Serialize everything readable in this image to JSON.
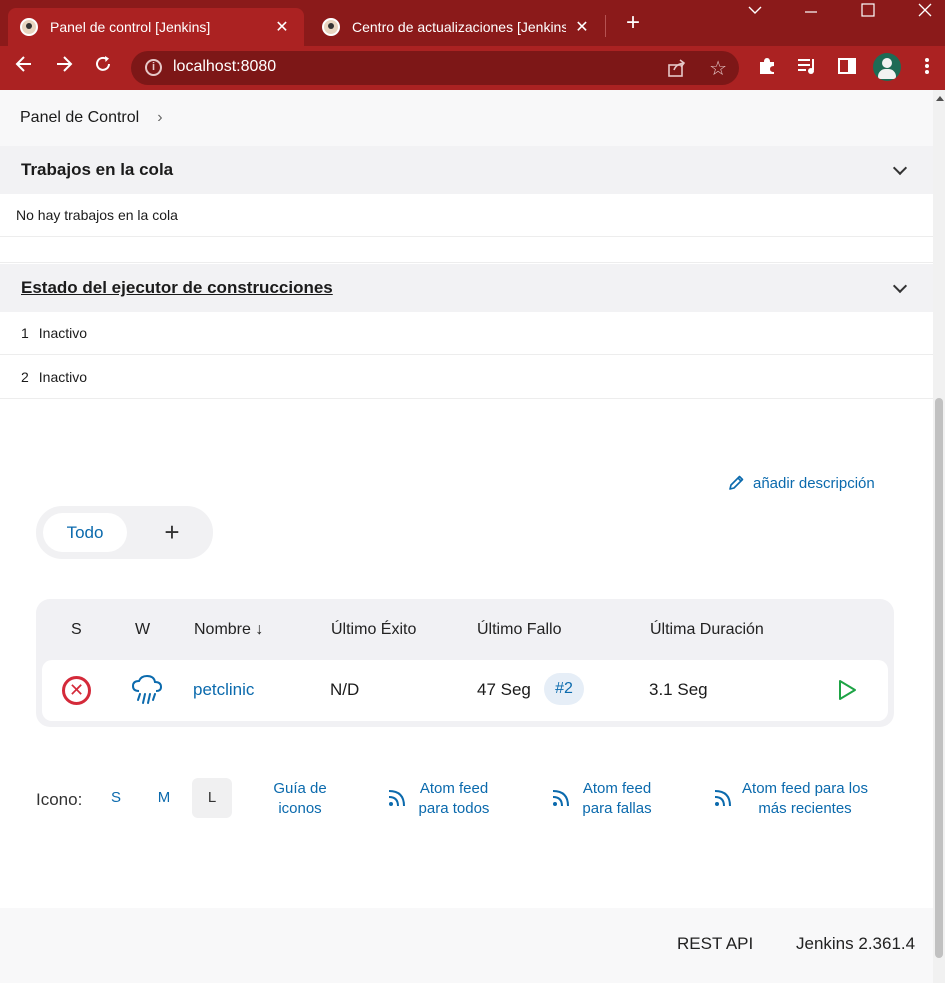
{
  "browser": {
    "tabs": [
      {
        "title": "Panel de control [Jenkins]",
        "close": "✕"
      },
      {
        "title": "Centro de actualizaciones [Jenkins]",
        "close": "✕"
      }
    ],
    "new_tab": "+",
    "url": "localhost:8080"
  },
  "breadcrumb": {
    "item": "Panel de Control",
    "separator": "›"
  },
  "queue": {
    "title": "Trabajos en la cola",
    "empty_text": "No hay trabajos en la cola"
  },
  "executors": {
    "title": "Estado del ejecutor de construcciones",
    "rows": [
      {
        "num": "1",
        "status": "Inactivo"
      },
      {
        "num": "2",
        "status": "Inactivo"
      }
    ]
  },
  "add_description": "añadir descripción",
  "views": {
    "active": "Todo",
    "add": "+"
  },
  "jobs_table": {
    "headers": {
      "s": "S",
      "w": "W",
      "name": "Nombre ↓",
      "last_success": "Último Éxito",
      "last_failure": "Último Fallo",
      "last_duration": "Última Duración"
    },
    "rows": [
      {
        "status": "failed",
        "weather": "rain",
        "name": "petclinic",
        "last_success": "N/D",
        "last_failure": "47 Seg",
        "build": "#2",
        "last_duration": "3.1 Seg"
      }
    ]
  },
  "legend": {
    "label": "Icono:",
    "sizes": [
      "S",
      "M",
      "L"
    ],
    "selected_size": "L",
    "icon_guide": "Guía de iconos",
    "feed_all": "Atom feed para todos",
    "feed_failures": "Atom feed para fallas",
    "feed_latest": "Atom feed para los más recientes"
  },
  "footer": {
    "rest_api": "REST API",
    "version": "Jenkins 2.361.4"
  },
  "colors": {
    "chrome": "#ab2222",
    "tabbar": "#8b1a1a",
    "link": "#0b6aad",
    "failed": "#d42a3a",
    "success": "#1ea446"
  }
}
